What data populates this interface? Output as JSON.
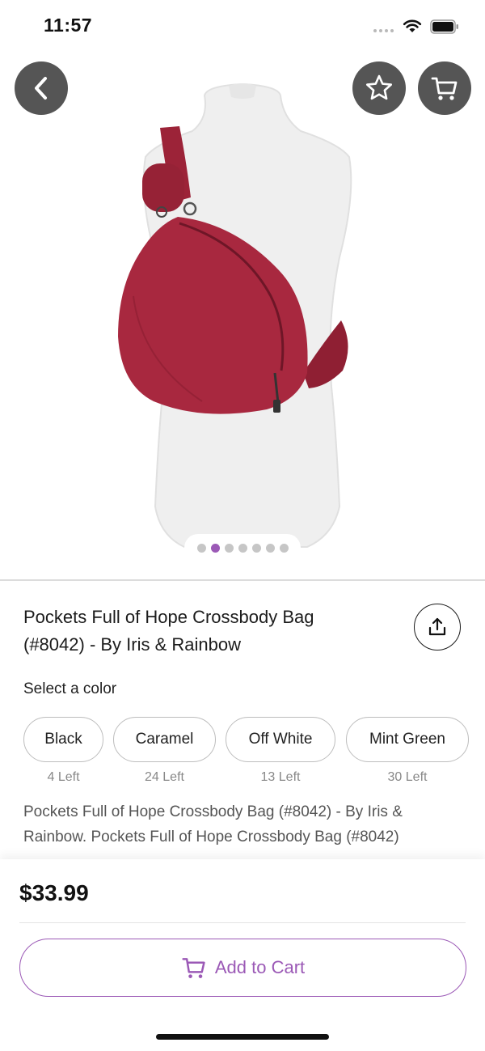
{
  "status_bar": {
    "time": "11:57"
  },
  "hero": {
    "icons": {
      "back": "chevron-left-icon",
      "favorite": "star-icon",
      "cart": "cart-icon"
    },
    "carousel": {
      "count": 7,
      "active_index": 1
    }
  },
  "product": {
    "title": "Pockets Full of Hope Crossbody Bag (#8042) - By Iris & Rainbow",
    "select_color_label": "Select a color",
    "colors": [
      {
        "name": "Black",
        "stock": "4 Left"
      },
      {
        "name": "Caramel",
        "stock": "24 Left"
      },
      {
        "name": "Off White",
        "stock": "13 Left"
      },
      {
        "name": "Mint Green",
        "stock": "30 Left"
      }
    ],
    "description": "Pockets Full of Hope Crossbody Bag (#8042) - By Iris & Rainbow. Pockets Full of Hope Crossbody Bag (#8042)"
  },
  "purchase": {
    "price": "$33.99",
    "add_to_cart_label": "Add to Cart"
  },
  "colors": {
    "accent": "#9b59b6",
    "button_bg": "#555555",
    "bag": "#a8283f"
  }
}
